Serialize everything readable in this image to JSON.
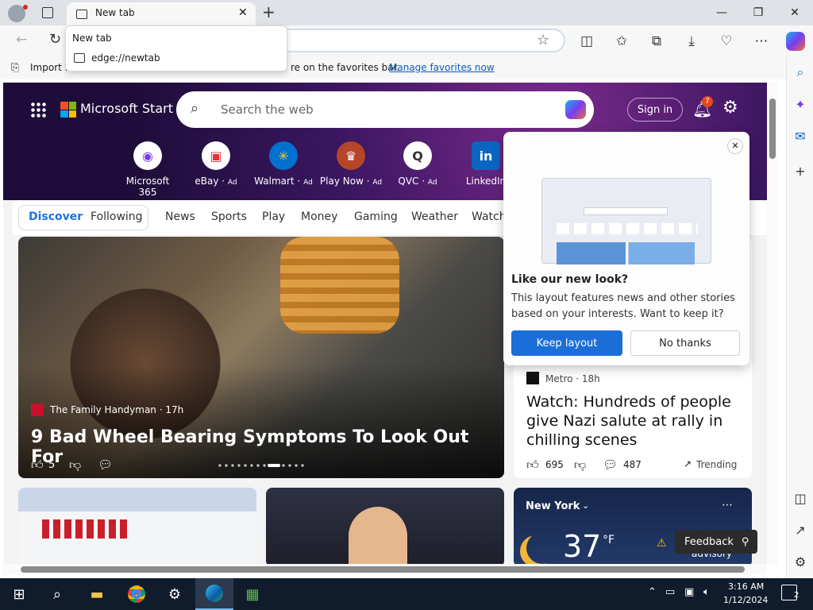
{
  "browser": {
    "tab_title": "New tab",
    "tab_popup": {
      "title": "New tab",
      "url": "edge://newtab"
    },
    "favbar": {
      "import_label": "Import fa",
      "middle_text": "re on the favorites bar.",
      "manage_link": "Manage favorites now"
    }
  },
  "msstart": {
    "brand": "Microsoft Start",
    "search_placeholder": "Search the web",
    "sign_in": "Sign in",
    "notification_count": "7",
    "quick_links": [
      {
        "label": "Microsoft 365",
        "ad": ""
      },
      {
        "label": "eBay",
        "ad": "Ad"
      },
      {
        "label": "Walmart",
        "ad": "Ad"
      },
      {
        "label": "Play Now",
        "ad": "Ad"
      },
      {
        "label": "QVC",
        "ad": "Ad"
      },
      {
        "label": "LinkedIn",
        "ad": ""
      }
    ],
    "nav": {
      "discover": "Discover",
      "following": "Following",
      "items": [
        "News",
        "Sports",
        "Play",
        "Money",
        "Gaming",
        "Weather",
        "Watch"
      ]
    }
  },
  "main_story": {
    "source": "The Family Handyman · 17h",
    "title": "9 Bad Wheel Bearing Symptoms To Look Out For",
    "likes": "5"
  },
  "side_story": {
    "source": "Metro · 18h",
    "title": "Watch: Hundreds of people give Nazi salute at rally in chilling scenes",
    "likes": "695",
    "comments": "487",
    "trending": "Trending"
  },
  "weather": {
    "location": "New York",
    "temp": "37",
    "unit": "°F",
    "alert": "advisory"
  },
  "feedback": "Feedback",
  "dialog": {
    "question": "Like our new look?",
    "body": "This layout features news and other stories based on your interests. Want to keep it?",
    "keep": "Keep layout",
    "no": "No thanks"
  },
  "taskbar": {
    "time": "3:16 AM",
    "date": "1/12/2024",
    "notifications": "2"
  },
  "colors": {
    "accent": "#1a73e8",
    "keep_button": "#1b6ed8",
    "taskbar": "#101c2c",
    "hero": "#3a1660"
  }
}
